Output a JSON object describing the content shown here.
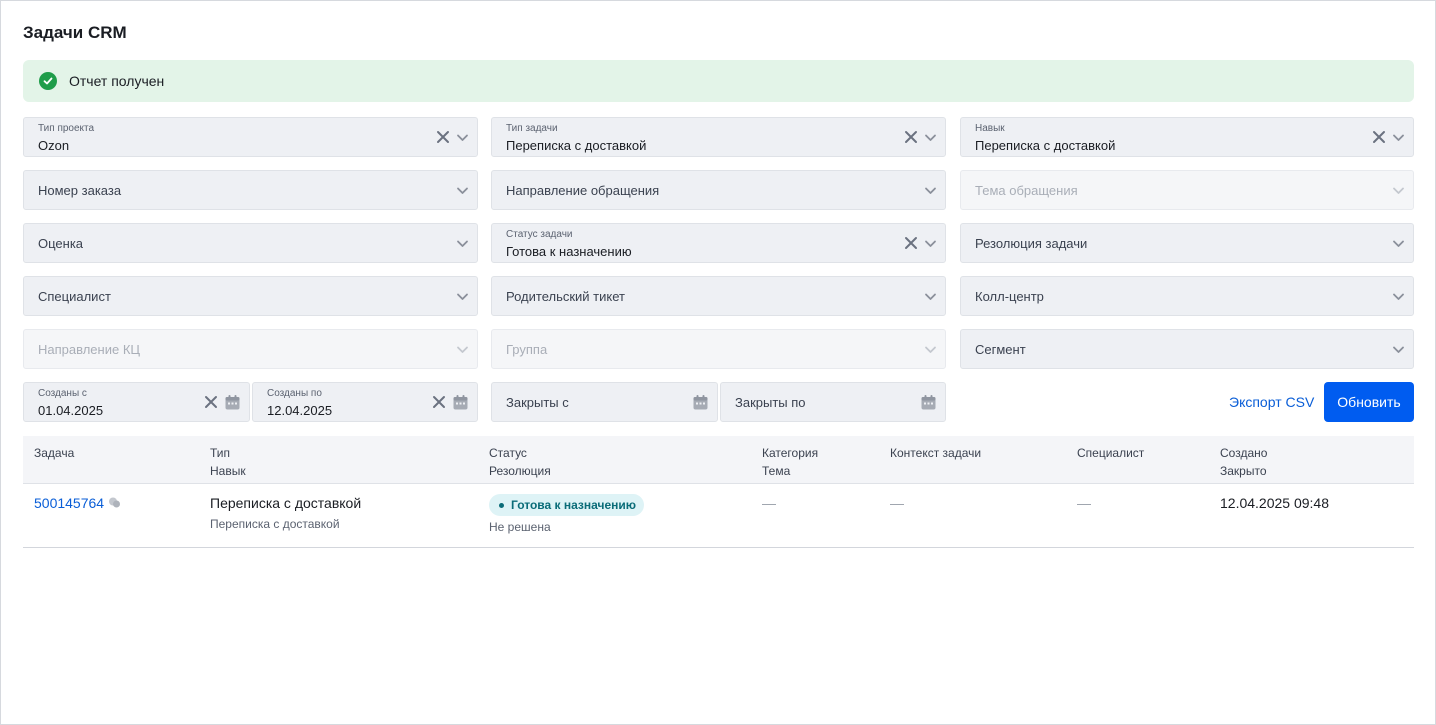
{
  "page": {
    "title": "Задачи CRM"
  },
  "alert": {
    "text": "Отчет получен",
    "color": "#1f9d4a"
  },
  "filters": {
    "project_type": {
      "label": "Тип проекта",
      "value": "Ozon"
    },
    "task_type": {
      "label": "Тип задачи",
      "value": "Переписка с доставкой"
    },
    "skill": {
      "label": "Навык",
      "value": "Переписка с доставкой"
    },
    "order_number": {
      "placeholder": "Номер заказа"
    },
    "request_direction": {
      "placeholder": "Направление обращения"
    },
    "request_topic": {
      "placeholder": "Тема обращения"
    },
    "rating": {
      "placeholder": "Оценка"
    },
    "task_status": {
      "label": "Статус задачи",
      "value": "Готова к назначению"
    },
    "task_resolution": {
      "placeholder": "Резолюция задачи"
    },
    "specialist": {
      "placeholder": "Специалист"
    },
    "parent_ticket": {
      "placeholder": "Родительский тикет"
    },
    "call_center": {
      "placeholder": "Колл-центр"
    },
    "cc_direction": {
      "placeholder": "Направление КЦ"
    },
    "group": {
      "placeholder": "Группа"
    },
    "segment": {
      "placeholder": "Сегмент"
    },
    "created_from": {
      "label": "Созданы с",
      "value": "01.04.2025"
    },
    "created_to": {
      "label": "Созданы по",
      "value": "12.04.2025"
    },
    "closed_from": {
      "placeholder": "Закрыты с"
    },
    "closed_to": {
      "placeholder": "Закрыты по"
    }
  },
  "actions": {
    "export_csv": "Экспорт CSV",
    "refresh": "Обновить",
    "primary_color": "#005cf0"
  },
  "table": {
    "columns": [
      {
        "top": "Задача",
        "bottom": ""
      },
      {
        "top": "Тип",
        "bottom": "Навык"
      },
      {
        "top": "Статус",
        "bottom": "Резолюция"
      },
      {
        "top": "Категория",
        "bottom": "Тема"
      },
      {
        "top": "Контекст задачи",
        "bottom": ""
      },
      {
        "top": "Специалист",
        "bottom": ""
      },
      {
        "top": "Создано",
        "bottom": "Закрыто"
      }
    ],
    "rows": [
      {
        "id": "500145764",
        "type": "Переписка с доставкой",
        "skill": "Переписка с доставкой",
        "status": "Готова к назначению",
        "resolution": "Не решена",
        "category": "—",
        "context": "—",
        "specialist": "—",
        "created": "12.04.2025 09:48"
      }
    ]
  }
}
